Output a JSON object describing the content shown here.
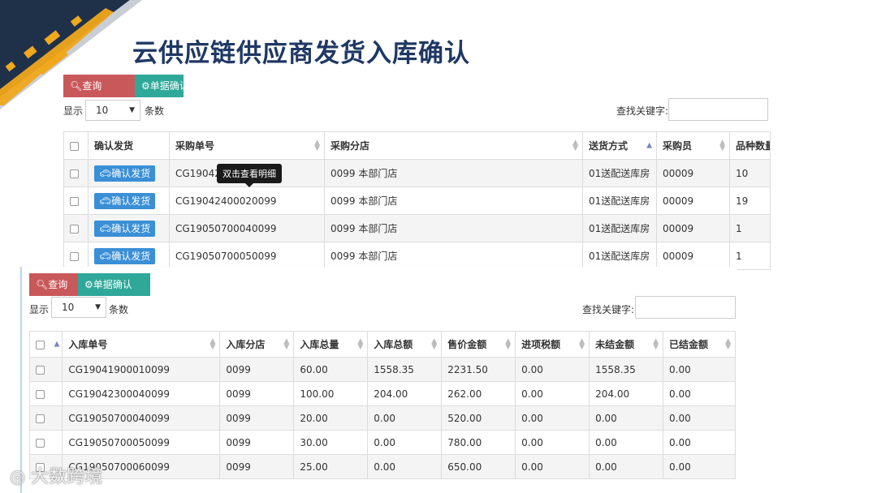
{
  "slide_title": "云供应链供应商发货入库确认",
  "colors": {
    "title": "#1f3864",
    "query_btn": "#c9585a",
    "confirm_btn": "#2fa89a",
    "row_confirm": "#3a8fd6",
    "corner_dark": "#1f3049",
    "corner_accent": "#f0a81c"
  },
  "top": {
    "query_label": "查询",
    "confirm_label": "单据确认",
    "show_label": "显示",
    "page_size": "10",
    "entries_label": "条数",
    "search_label": "查找关键字:",
    "tooltip": "双击查看明细",
    "headers": [
      "确认发货",
      "采购单号",
      "采购分店",
      "送货方式",
      "采购员",
      "品种数量"
    ],
    "row_button": "确认发货",
    "rows": [
      {
        "po": "CG19042",
        "store": "0099 本部门店",
        "delivery": "01送配送库房",
        "buyer": "00009",
        "count": "10"
      },
      {
        "po": "CG19042400020099",
        "store": "0099 本部门店",
        "delivery": "01送配送库房",
        "buyer": "00009",
        "count": "19"
      },
      {
        "po": "CG19050700040099",
        "store": "0099 本部门店",
        "delivery": "01送配送库房",
        "buyer": "00009",
        "count": "1"
      },
      {
        "po": "CG19050700050099",
        "store": "0099 本部门店",
        "delivery": "01送配送库房",
        "buyer": "00009",
        "count": "1"
      }
    ]
  },
  "bottom": {
    "query_label": "查询",
    "confirm_label": "单据确认",
    "show_label": "显示",
    "page_size": "10",
    "entries_label": "条数",
    "search_label": "查找关键字:",
    "headers": [
      "入库单号",
      "入库分店",
      "入库总量",
      "入库总额",
      "售价金额",
      "进项税额",
      "未结金额",
      "已结金额"
    ],
    "rows": [
      [
        "CG19041900010099",
        "0099",
        "60.00",
        "1558.35",
        "2231.50",
        "0.00",
        "1558.35",
        "0.00"
      ],
      [
        "CG19042300040099",
        "0099",
        "100.00",
        "204.00",
        "262.00",
        "0.00",
        "204.00",
        "0.00"
      ],
      [
        "CG19050700040099",
        "0099",
        "20.00",
        "0.00",
        "520.00",
        "0.00",
        "0.00",
        "0.00"
      ],
      [
        "CG19050700050099",
        "0099",
        "30.00",
        "0.00",
        "780.00",
        "0.00",
        "0.00",
        "0.00"
      ],
      [
        "CG19050700060099",
        "0099",
        "25.00",
        "0.00",
        "650.00",
        "0.00",
        "0.00",
        "0.00"
      ]
    ]
  },
  "watermark": "大数跨境"
}
